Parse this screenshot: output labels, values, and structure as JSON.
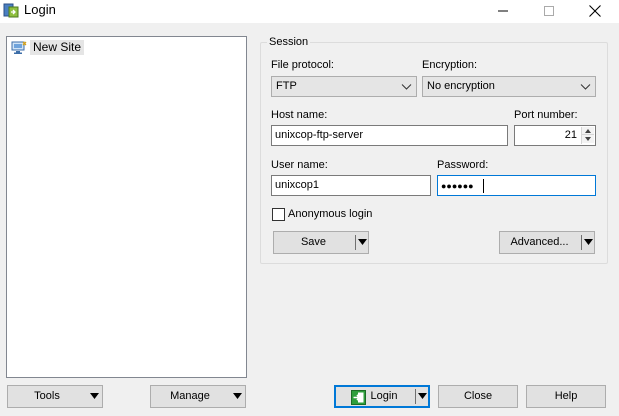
{
  "window": {
    "title": "Login",
    "icon": "winscp-app-icon"
  },
  "site_tree": {
    "items": [
      {
        "label": "New Site",
        "icon": "new-site-computer-icon",
        "selected": true
      }
    ]
  },
  "session": {
    "group_title": "Session",
    "file_protocol": {
      "label": "File protocol:",
      "value": "FTP"
    },
    "encryption": {
      "label": "Encryption:",
      "value": "No encryption"
    },
    "host_name": {
      "label": "Host name:",
      "value": "unixcop-ftp-server"
    },
    "port_number": {
      "label": "Port number:",
      "value": "21"
    },
    "user_name": {
      "label": "User name:",
      "value": "unixcop1"
    },
    "password": {
      "label": "Password:",
      "value": "●●●●●●"
    },
    "anonymous_login": {
      "label": "Anonymous login",
      "checked": false
    },
    "save_button": "Save",
    "advanced_button": "Advanced..."
  },
  "bottom": {
    "tools_button": "Tools",
    "manage_button": "Manage",
    "login_button": "Login",
    "close_button": "Close",
    "help_button": "Help"
  },
  "colors": {
    "focus_border": "#0078d7",
    "window_bg": "#f0f0f0",
    "login_icon_green": "#2e9e3c"
  }
}
